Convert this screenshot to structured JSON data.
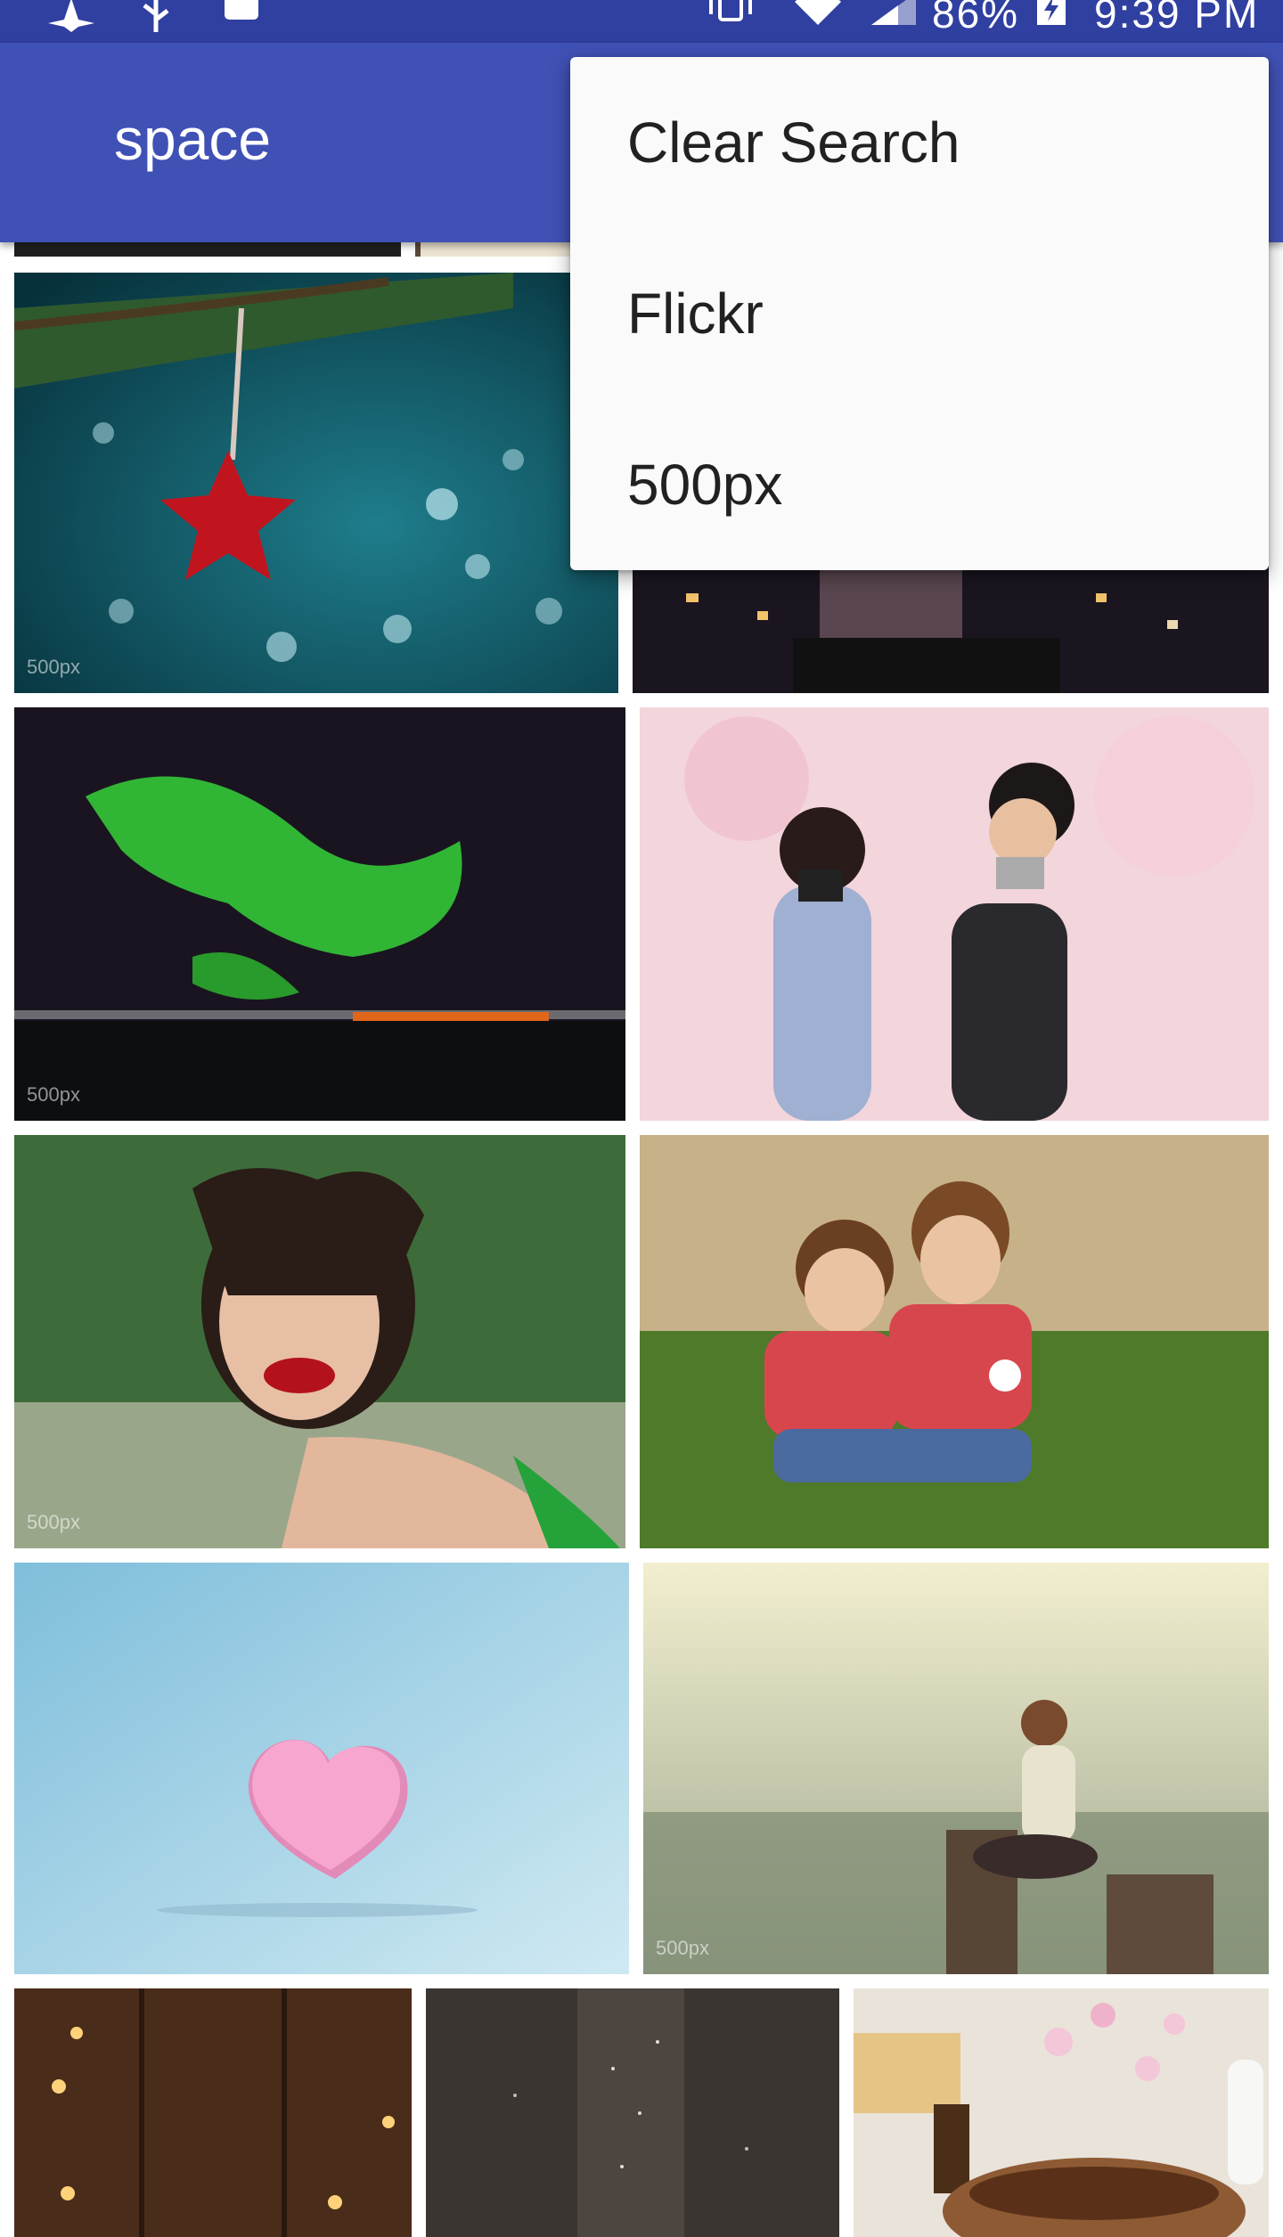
{
  "status_bar": {
    "battery": "86%",
    "time": "9:39 PM"
  },
  "app_bar": {
    "title": "space"
  },
  "menu": {
    "items": [
      {
        "label": "Clear Search"
      },
      {
        "label": "Flickr"
      },
      {
        "label": "500px"
      }
    ]
  },
  "photos": {
    "watermark": "500px"
  },
  "colors": {
    "primary": "#3f51b5",
    "primary_dark": "#3040a0",
    "menu_background": "#fafafa"
  },
  "icons": [
    "app-notification-icon",
    "usb-icon",
    "android-icon",
    "vibrate-icon",
    "wifi-icon",
    "signal-icon",
    "battery-charging-icon"
  ]
}
